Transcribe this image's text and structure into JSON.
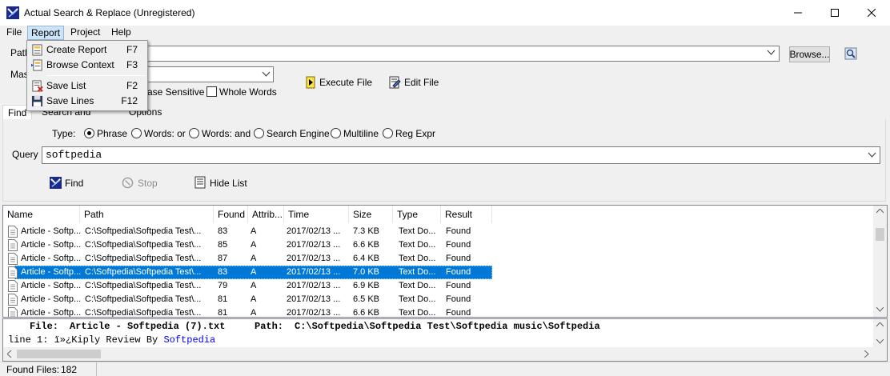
{
  "window": {
    "title": "Actual Search & Replace (Unregistered)"
  },
  "menu": [
    "File",
    "Report",
    "Project",
    "Help"
  ],
  "report_menu": [
    {
      "label": "Create Report",
      "shortcut": "F7"
    },
    {
      "label": "Browse Context",
      "shortcut": "F3"
    },
    {
      "label": "Save List",
      "shortcut": "F2"
    },
    {
      "label": "Save Lines",
      "shortcut": "F12"
    }
  ],
  "toolbar": {
    "path_label_visible": "Path",
    "mask_label_visible": "Mas",
    "path_value": "",
    "browse_label": "Browse...",
    "case_sensitive_label_visible": "ase Sensitive",
    "whole_words_label": "Whole Words",
    "execute_file_label": "Execute File",
    "edit_file_label": "Edit File"
  },
  "tabs": {
    "find": "Find",
    "search_replace_visible": "Search and Replace",
    "options": "Options"
  },
  "find": {
    "type_label": "Type:",
    "types": [
      "Phrase",
      "Words: or",
      "Words: and",
      "Search Engine",
      "Multiline",
      "Reg Expr"
    ],
    "selected_type": "Phrase",
    "query_label": "Query",
    "query_value": "softpedia",
    "find_label": "Find",
    "stop_label": "Stop",
    "hide_list_label": "Hide List"
  },
  "results": {
    "columns": [
      "Name",
      "Path",
      "Found",
      "Attrib...",
      "Time",
      "Size",
      "Type",
      "Result"
    ],
    "rows": [
      [
        "Article - Softp...",
        "C:\\Softpedia\\Softpedia Test\\...",
        "83",
        "A",
        "2017/02/13 ...",
        "7.3 KB",
        "Text Do...",
        "Found"
      ],
      [
        "Article - Softp...",
        "C:\\Softpedia\\Softpedia Test\\...",
        "85",
        "A",
        "2017/02/13 ...",
        "6.6 KB",
        "Text Do...",
        "Found"
      ],
      [
        "Article - Softp...",
        "C:\\Softpedia\\Softpedia Test\\...",
        "87",
        "A",
        "2017/02/13 ...",
        "6.4 KB",
        "Text Do...",
        "Found"
      ],
      [
        "Article - Softp...",
        "C:\\Softpedia\\Softpedia Test\\...",
        "83",
        "A",
        "2017/02/13 ...",
        "7.0 KB",
        "Text Do...",
        "Found"
      ],
      [
        "Article - Softp...",
        "C:\\Softpedia\\Softpedia Test\\...",
        "79",
        "A",
        "2017/02/13 ...",
        "6.9 KB",
        "Text Do...",
        "Found"
      ],
      [
        "Article - Softp...",
        "C:\\Softpedia\\Softpedia Test\\...",
        "81",
        "A",
        "2017/02/13 ...",
        "6.5 KB",
        "Text Do...",
        "Found"
      ],
      [
        "Article - Softp...",
        "C:\\Softpedia\\Softpedia Test\\...",
        "81",
        "A",
        "2017/02/13 ...",
        "6.6 KB",
        "Text Do...",
        "Found"
      ]
    ],
    "selected_row": 3
  },
  "preview": {
    "file_label": "File:",
    "file_value": "Article - Softpedia (7).txt",
    "path_label": "Path:",
    "path_value": "C:\\Softpedia\\Softpedia Test\\Softpedia music\\Softpedia",
    "line_prefix": "line 1: ï»¿Kiply Review By ",
    "line_match": "Softpedia"
  },
  "status": {
    "found_files_label": "Found Files:",
    "found_files_value": "182"
  },
  "colors": {
    "selection": "#0078d7",
    "match": "#0000ff"
  }
}
